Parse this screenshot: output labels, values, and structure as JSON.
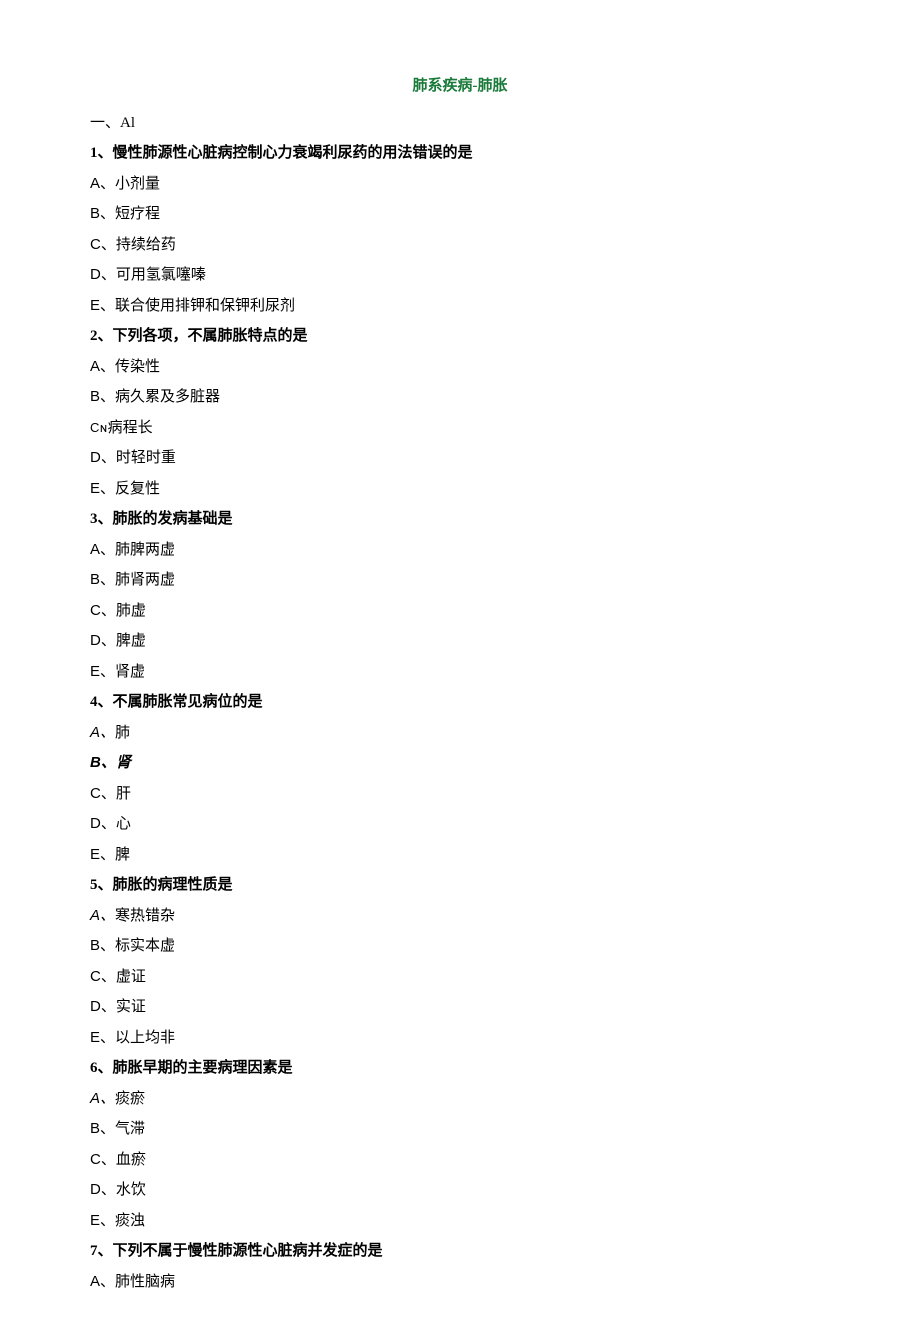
{
  "title": "肺系疾病-肺胀",
  "section": "一、Al",
  "questions": [
    {
      "q": "1、慢性肺源性心脏病控制心力衰竭利尿药的用法错误的是",
      "opts": [
        {
          "l": "A、",
          "t": "小剂量",
          "style": "normal"
        },
        {
          "l": "B、",
          "t": "短疗程",
          "style": "normal"
        },
        {
          "l": "C、",
          "t": "持续给药",
          "style": "normal"
        },
        {
          "l": "D、",
          "t": "可用氢氯噻嗪",
          "style": "normal"
        },
        {
          "l": "E、",
          "t": "联合使用排钾和保钾利尿剂",
          "style": "normal"
        }
      ]
    },
    {
      "q": "2、下列各项，不属肺胀特点的是",
      "opts": [
        {
          "l": "A、",
          "t": "传染性",
          "style": "normal"
        },
        {
          "l": "B、",
          "t": "病久累及多脏器",
          "style": "normal"
        },
        {
          "l": "Cɴ",
          "t": "病程长",
          "style": "cn-small"
        },
        {
          "l": "D、",
          "t": "时轻时重",
          "style": "normal"
        },
        {
          "l": "E、",
          "t": "反复性",
          "style": "normal"
        }
      ]
    },
    {
      "q": "3、肺胀的发病基础是",
      "opts": [
        {
          "l": "A、",
          "t": "肺脾两虚",
          "style": "normal"
        },
        {
          "l": "B、",
          "t": "肺肾两虚",
          "style": "normal"
        },
        {
          "l": "C、",
          "t": "肺虚",
          "style": "normal"
        },
        {
          "l": "D、",
          "t": "脾虚",
          "style": "normal"
        },
        {
          "l": "E、",
          "t": "肾虚",
          "style": "normal"
        }
      ]
    },
    {
      "q": "4、不属肺胀常见病位的是",
      "opts": [
        {
          "l": "A、",
          "t": "肺",
          "style": "italic-letter"
        },
        {
          "l": "B、",
          "t": "肾",
          "style": "italic-both"
        },
        {
          "l": "C、",
          "t": "肝",
          "style": "normal"
        },
        {
          "l": "D、",
          "t": "心",
          "style": "normal"
        },
        {
          "l": "E、",
          "t": "脾",
          "style": "normal"
        }
      ]
    },
    {
      "q": "5、肺胀的病理性质是",
      "opts": [
        {
          "l": "A、",
          "t": "寒热错杂",
          "style": "italic-letter"
        },
        {
          "l": "B、",
          "t": "标实本虚",
          "style": "normal"
        },
        {
          "l": "C、",
          "t": "虚证",
          "style": "normal"
        },
        {
          "l": "D、",
          "t": "实证",
          "style": "normal"
        },
        {
          "l": "E、",
          "t": "以上均非",
          "style": "normal"
        }
      ]
    },
    {
      "q": "6、肺胀早期的主要病理因素是",
      "opts": [
        {
          "l": "A、",
          "t": "痰瘀",
          "style": "italic-letter"
        },
        {
          "l": "B、",
          "t": "气滞",
          "style": "normal"
        },
        {
          "l": "C、",
          "t": "血瘀",
          "style": "normal"
        },
        {
          "l": "D、",
          "t": "水饮",
          "style": "normal"
        },
        {
          "l": "E、",
          "t": "痰浊",
          "style": "normal"
        }
      ]
    },
    {
      "q": "7、下列不属于慢性肺源性心脏病并发症的是",
      "opts": [
        {
          "l": "A、",
          "t": "肺性脑病",
          "style": "normal"
        }
      ]
    }
  ]
}
